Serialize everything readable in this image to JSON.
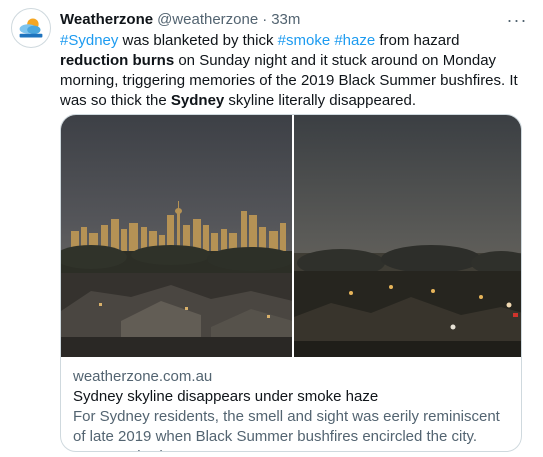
{
  "tweet": {
    "author": {
      "name": "Weatherzone",
      "handle": "@weatherzone",
      "separator": "·",
      "time": "33m",
      "avatar_icon": "weatherzone-logo-icon"
    },
    "more_icon": "more-options-icon",
    "text": {
      "t1": "#Sydney",
      "t2": " was blanketed by thick ",
      "t3": "#smoke",
      "t4": " ",
      "t5": "#haze",
      "t6": " from hazard ",
      "t7": "reduction burns",
      "t8": " on Sunday night and it stuck around on Monday morning, triggering memories of the 2019 Black Summer bushfires. It was so thick the ",
      "t9": "Sydney",
      "t10": " skyline literally disappeared."
    },
    "card": {
      "domain": "weatherzone.com.au",
      "title": "Sydney skyline disappears under smoke haze",
      "description": "For Sydney residents, the smell and sight was eerily reminiscent of late 2019 when Black Summer bushfires encircled the city. Fortunately, th..."
    }
  },
  "colors": {
    "link": "#1d9bf0",
    "secondary_text": "#536471",
    "border": "#cfd9de",
    "primary_text": "#0f1419"
  }
}
